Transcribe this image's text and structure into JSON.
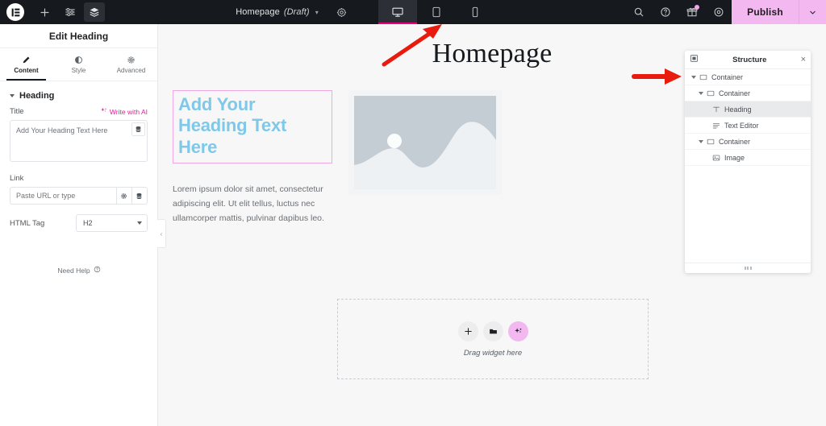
{
  "topbar": {
    "logo_icon": "elementor-logo-icon",
    "add_icon": "plus-icon",
    "settings_sliders_icon": "sliders-icon",
    "layers_icon": "layers-icon",
    "document_title": "Homepage",
    "document_status": "(Draft)",
    "document_chevron_icon": "chevron-down-icon",
    "page_settings_icon": "gear-icon",
    "devices": [
      {
        "name": "desktop",
        "icon": "desktop-icon",
        "active": true
      },
      {
        "name": "tablet",
        "icon": "tablet-icon",
        "active": false
      },
      {
        "name": "mobile",
        "icon": "mobile-icon",
        "active": false
      }
    ],
    "search_icon": "search-icon",
    "help_icon": "help-circle-icon",
    "gift_icon": "gift-icon",
    "preview_icon": "eye-icon",
    "publish_label": "Publish",
    "publish_chevron_icon": "chevron-down-icon",
    "publish_color": "#f3b8f0",
    "bar_color": "#16191d"
  },
  "panel": {
    "header_title": "Edit Heading",
    "tabs": [
      {
        "label": "Content",
        "icon": "pencil-icon",
        "active": true
      },
      {
        "label": "Style",
        "icon": "contrast-circle-icon",
        "active": false
      },
      {
        "label": "Advanced",
        "icon": "gear-icon",
        "active": false
      }
    ],
    "section": {
      "title": "Heading",
      "collapse_icon": "caret-down-icon"
    },
    "title_control": {
      "label": "Title",
      "ai_label": "Write with AI",
      "ai_icon": "sparkle-icon",
      "ai_color": "#e8199e",
      "value": "Add Your Heading Text Here",
      "dynamic_tag_icon": "database-icon"
    },
    "link_control": {
      "label": "Link",
      "placeholder": "Paste URL or type",
      "value": "",
      "options_icon": "gear-icon",
      "dynamic_tag_icon": "database-icon"
    },
    "html_tag_control": {
      "label": "HTML Tag",
      "value": "H2",
      "chevron_icon": "caret-down-icon"
    },
    "need_help": {
      "label": "Need Help",
      "icon": "question-circle-icon"
    },
    "collapse_handle_icon": "chevron-left-icon"
  },
  "canvas": {
    "site_title": "Homepage",
    "heading_widget": {
      "text": "Add Your Heading Text Here",
      "text_color": "#7fc8e8",
      "selection_border_color": "#f0a8e3",
      "selected": true
    },
    "text_editor_widget": {
      "text": "Lorem ipsum dolor sit amet, consectetur adipiscing elit. Ut elit tellus, luctus nec ullamcorper mattis, pulvinar dapibus leo."
    },
    "image_widget": {
      "icon": "image-placeholder-icon"
    },
    "dropzone": {
      "label": "Drag widget here",
      "buttons": [
        {
          "name": "add-element",
          "icon": "plus-icon"
        },
        {
          "name": "add-template",
          "icon": "folder-icon"
        },
        {
          "name": "ai-builder",
          "icon": "sparkle-icon",
          "color": "#f3b8f0"
        }
      ]
    },
    "background_color": "#f7f7f7"
  },
  "structure": {
    "toggle_icon": "navigator-icon",
    "title": "Structure",
    "close_icon": "close-icon",
    "resize_icon": "grip-dots-icon",
    "tree": [
      {
        "label": "Container",
        "icon": "container-icon",
        "depth": 0,
        "expandable": true,
        "selected": false
      },
      {
        "label": "Container",
        "icon": "container-icon",
        "depth": 1,
        "expandable": true,
        "selected": false
      },
      {
        "label": "Heading",
        "icon": "heading-t-icon",
        "depth": 2,
        "expandable": false,
        "selected": true
      },
      {
        "label": "Text Editor",
        "icon": "text-editor-icon",
        "depth": 2,
        "expandable": false,
        "selected": false
      },
      {
        "label": "Container",
        "icon": "container-icon",
        "depth": 1,
        "expandable": true,
        "selected": false
      },
      {
        "label": "Image",
        "icon": "image-icon",
        "depth": 2,
        "expandable": false,
        "selected": false
      }
    ]
  },
  "annotations": {
    "arrow_color": "#e81b0e",
    "arrows": [
      {
        "name": "arrow-to-desktop-device-button"
      },
      {
        "name": "arrow-to-structure-container"
      }
    ]
  }
}
